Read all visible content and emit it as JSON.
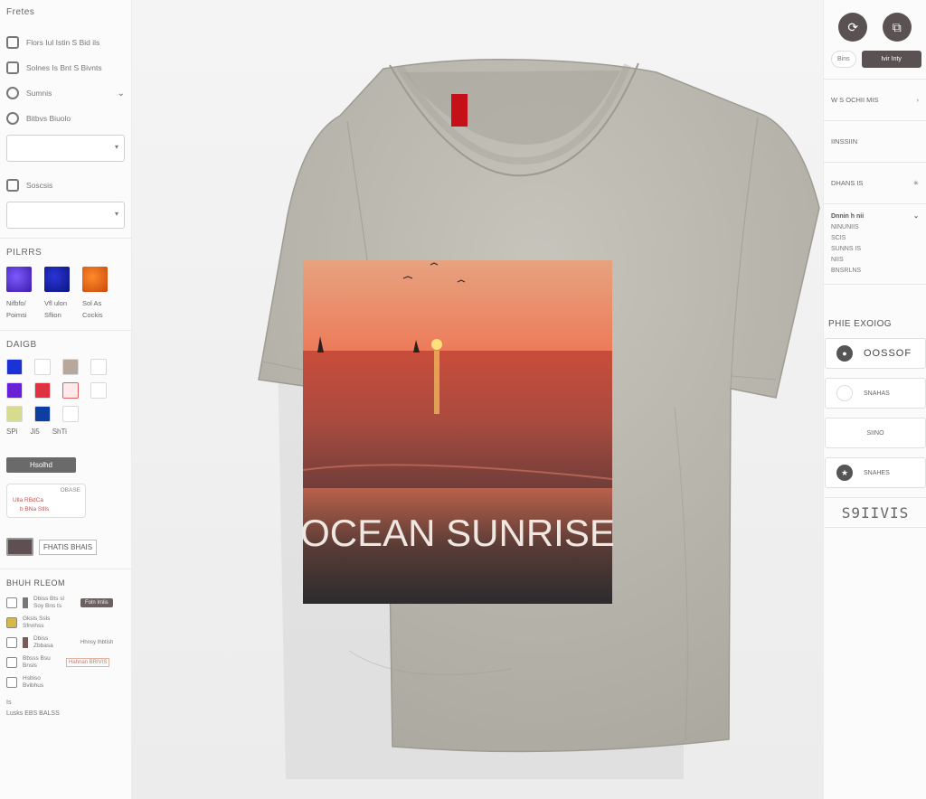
{
  "left": {
    "section_title": "Fretes",
    "filters": [
      {
        "label": "Flors Iul Istin S Bid ils"
      },
      {
        "label": "Solnes Is Bnt S Bivnts"
      },
      {
        "label": "Sumnis"
      },
      {
        "label": "Bitbvs Biuolo"
      }
    ],
    "filter5": "Soscsis",
    "patterns_title": "PILRRS",
    "patterns": [
      {
        "label": "Nifbfo/ Poimsi",
        "color": "#5a2fd3"
      },
      {
        "label": "Vfl ulon Sflion",
        "color": "#1a24b5"
      },
      {
        "label": "Sol As Cockis",
        "color": "#e2641a"
      }
    ],
    "colors_title": "DAIGB",
    "swatches": [
      "#1a33d6",
      "#ffffff",
      "#b7a79c",
      "#ffffff",
      "#6a1fd6",
      "#e03141",
      "#ffe9ea",
      "#ffffff",
      "#d6dc8c",
      "#0d3fa2",
      "#ffffff"
    ],
    "swatch_labels": [
      "SPi",
      "Ji5",
      "ShTi"
    ],
    "dark_button": "Hsolhd",
    "card": {
      "r": "OBASE",
      "l": "Ulla RBdCa",
      "l2": "b BNa Stlls"
    },
    "chip_label": "FHATIS BHAIS",
    "layers_title": "BHUH RLEOM",
    "layers": [
      {
        "text": "Dbiss Bts sl Soy Bns ts",
        "pill": "Foln Imlis"
      },
      {
        "text": "Gksls Ssls Sfnnhss",
        "pill": ""
      },
      {
        "text": "Dbiss Zbbasa",
        "pill": "Hhnsy Ihbtish"
      },
      {
        "text": "Bbsss Bsu Bnsls",
        "pill": "Hahnan BRIVIS"
      },
      {
        "text": "Hsbiso Bvibhus",
        "pill": ""
      }
    ],
    "foot1": "Is",
    "foot2": "Lusks   EBS BALSS"
  },
  "shirt": {
    "print_text": "OCEAN SUNRISE",
    "color": "#bdbbb1"
  },
  "right": {
    "segments": [
      "Bins",
      "Ivir Inty"
    ],
    "rows": [
      "W S OCHII MIS",
      "IINSSIIN",
      "DHANS IS"
    ],
    "list_head": "Dnnin h nii",
    "list_items": [
      "NINUNIIS",
      "SCIS",
      "SUNNS IS",
      "NIIS",
      "BNSRLNS"
    ],
    "price_title": "PHIE EXOIOG",
    "price_rows": [
      {
        "label": "OOSSOF",
        "dot": "dark"
      },
      {
        "label": "SNAHAS",
        "dot": "light"
      },
      {
        "label": "SIINO",
        "dot": "none"
      },
      {
        "label": "SNAHES",
        "dot": "dark"
      }
    ],
    "total": "S9IIVIS"
  }
}
